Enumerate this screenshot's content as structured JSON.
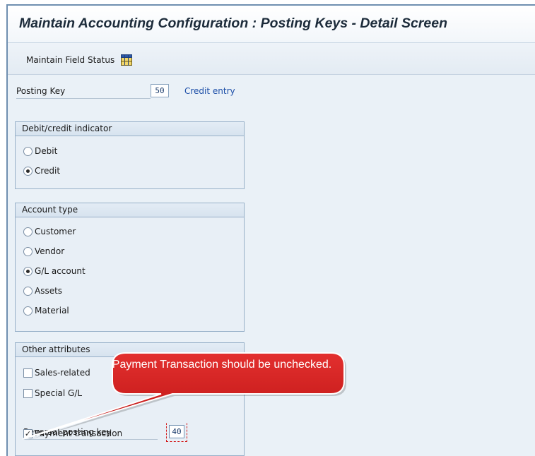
{
  "window": {
    "title": "Maintain Accounting Configuration : Posting Keys - Detail Screen"
  },
  "toolbar": {
    "field_status_label": "Maintain Field Status",
    "field_status_icon": "grid-table-icon"
  },
  "posting_key": {
    "label": "Posting Key",
    "value": "50",
    "description": "Credit entry"
  },
  "debit_credit": {
    "title": "Debit/credit indicator",
    "options": [
      {
        "label": "Debit",
        "selected": false
      },
      {
        "label": "Credit",
        "selected": true
      }
    ]
  },
  "account_type": {
    "title": "Account type",
    "options": [
      {
        "label": "Customer",
        "selected": false
      },
      {
        "label": "Vendor",
        "selected": false
      },
      {
        "label": "G/L account",
        "selected": true
      },
      {
        "label": "Assets",
        "selected": false
      },
      {
        "label": "Material",
        "selected": false
      }
    ]
  },
  "other_attributes": {
    "title": "Other attributes",
    "sales_related": {
      "label": "Sales-related",
      "checked": false
    },
    "special_gl": {
      "label": "Special G/L",
      "checked": false
    },
    "reversal_posting_key": {
      "label": "Reversal posting key",
      "value": "40"
    },
    "payment_transaction": {
      "label": "Payment transaction",
      "checked": true
    }
  },
  "callout": {
    "text": "Payment Transaction should be unchecked.",
    "fill_color": "#d21a1a"
  },
  "colors": {
    "header_blue": "#6f8fb0",
    "link_blue": "#1d4fa8",
    "panel_bg": "#eaf1f7"
  }
}
